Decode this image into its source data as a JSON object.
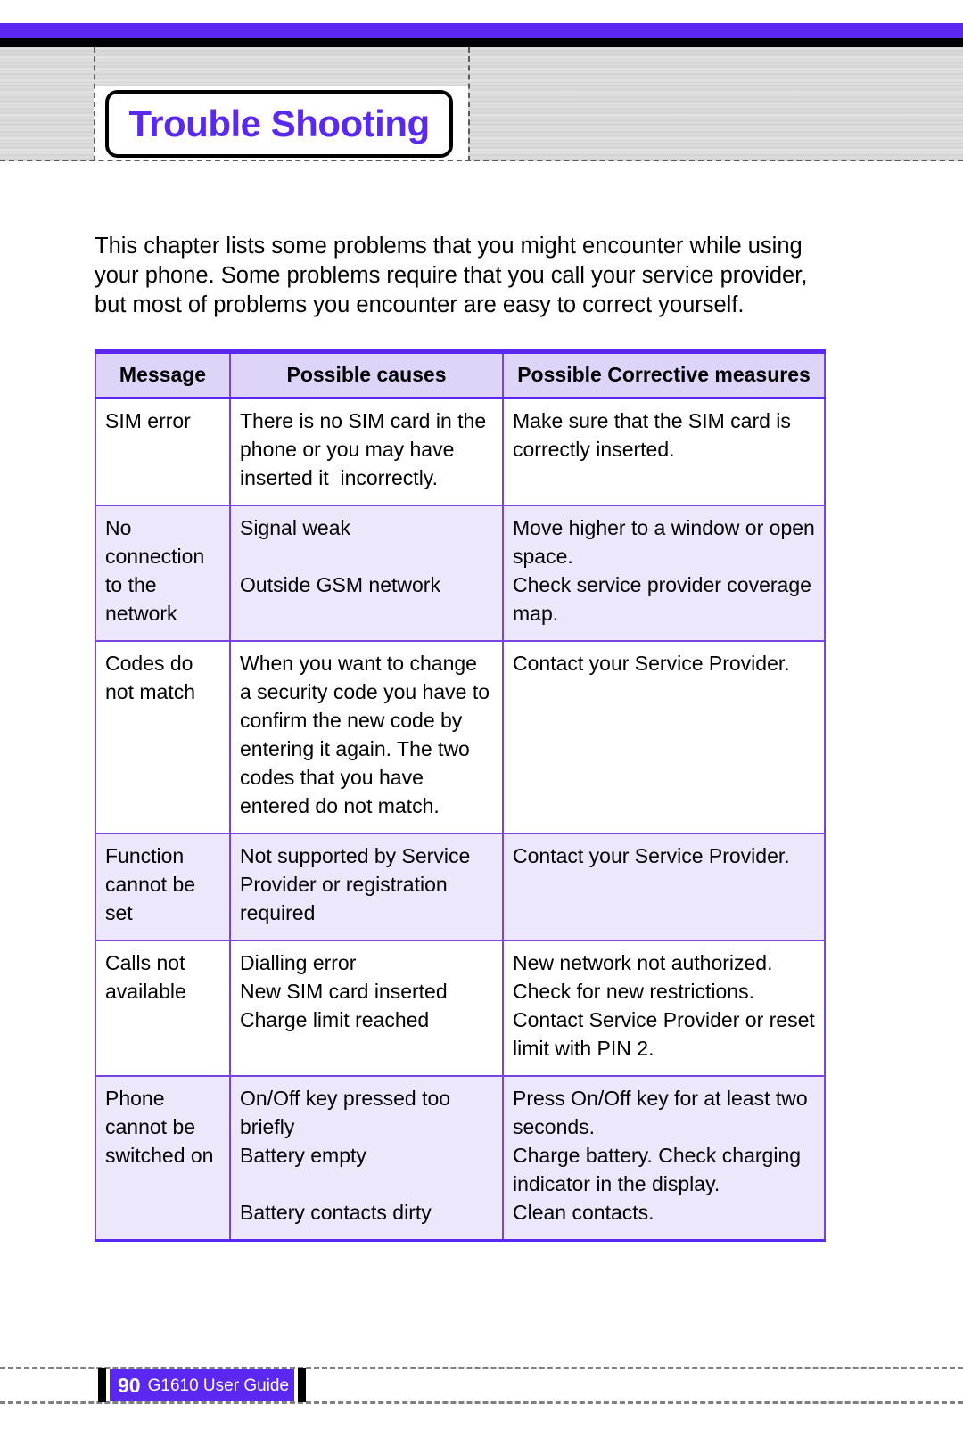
{
  "header": {
    "chapter_title": "Trouble Shooting",
    "accent_color": "#5a28f0",
    "title_border_color": "#000000"
  },
  "intro": {
    "paragraph": "This chapter lists some problems that you might encounter while using your phone. Some problems require that you call your service provider, but most of problems you encounter are easy to correct yourself."
  },
  "table": {
    "border_color": "#7744dd",
    "header_bg": "#ddd4f8",
    "alt_row_bg": "#ece7fb",
    "columns": [
      "Message",
      "Possible causes",
      "Possible Corrective measures"
    ],
    "rows": [
      {
        "message": [
          "SIM error"
        ],
        "causes": [
          "There is no SIM card in the phone or you may have inserted it  incorrectly."
        ],
        "measures": [
          "Make sure that the SIM card is correctly inserted."
        ]
      },
      {
        "message": [
          "No connection to the network"
        ],
        "causes": [
          "Signal weak",
          "Outside GSM network"
        ],
        "measures": [
          "Move higher to a window or open space.",
          "Check service provider coverage map."
        ]
      },
      {
        "message": [
          "Codes do not match"
        ],
        "causes": [
          "When you want to change a security code you have to confirm the new code by entering it again. The two codes that you have entered do not match."
        ],
        "measures": [
          "Contact your Service Provider."
        ]
      },
      {
        "message": [
          "Function cannot be set"
        ],
        "causes": [
          "Not supported by Service Provider or registration required"
        ],
        "measures": [
          "Contact your Service Provider."
        ]
      },
      {
        "message": [
          "Calls not available"
        ],
        "causes": [
          "Dialling error",
          "New SIM card inserted",
          "Charge limit reached"
        ],
        "measures": [
          "New network not authorized.",
          "Check for new restrictions.",
          "Contact Service Provider or reset limit with PIN 2."
        ]
      },
      {
        "message": [
          "Phone cannot be switched on"
        ],
        "causes": [
          "On/Off key pressed too briefly",
          "Battery empty",
          "Battery contacts dirty"
        ],
        "measures": [
          "Press On/Off key for at least two seconds.",
          "Charge battery. Check charging indicator in the display.",
          "Clean contacts."
        ]
      }
    ]
  },
  "footer": {
    "page_number": "90",
    "guide_title": "G1610 User Guide",
    "badge_color": "#5a28f0"
  }
}
